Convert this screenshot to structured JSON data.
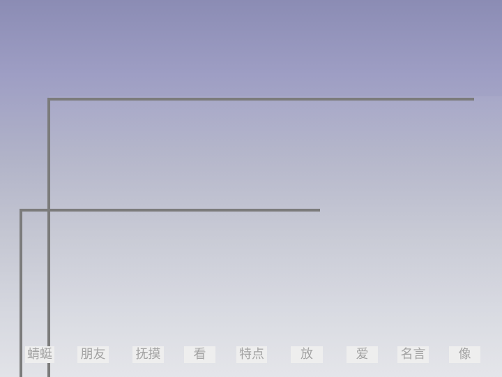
{
  "slide": {
    "words": [
      "蜻蜓",
      "朋友",
      "抚摸",
      "看",
      "特点",
      "放",
      "爱",
      "名言",
      "像"
    ]
  },
  "colors": {
    "line": "#7b7b7b",
    "chip_background": "#eeeeee",
    "chip_text": "#a3a3a3"
  }
}
